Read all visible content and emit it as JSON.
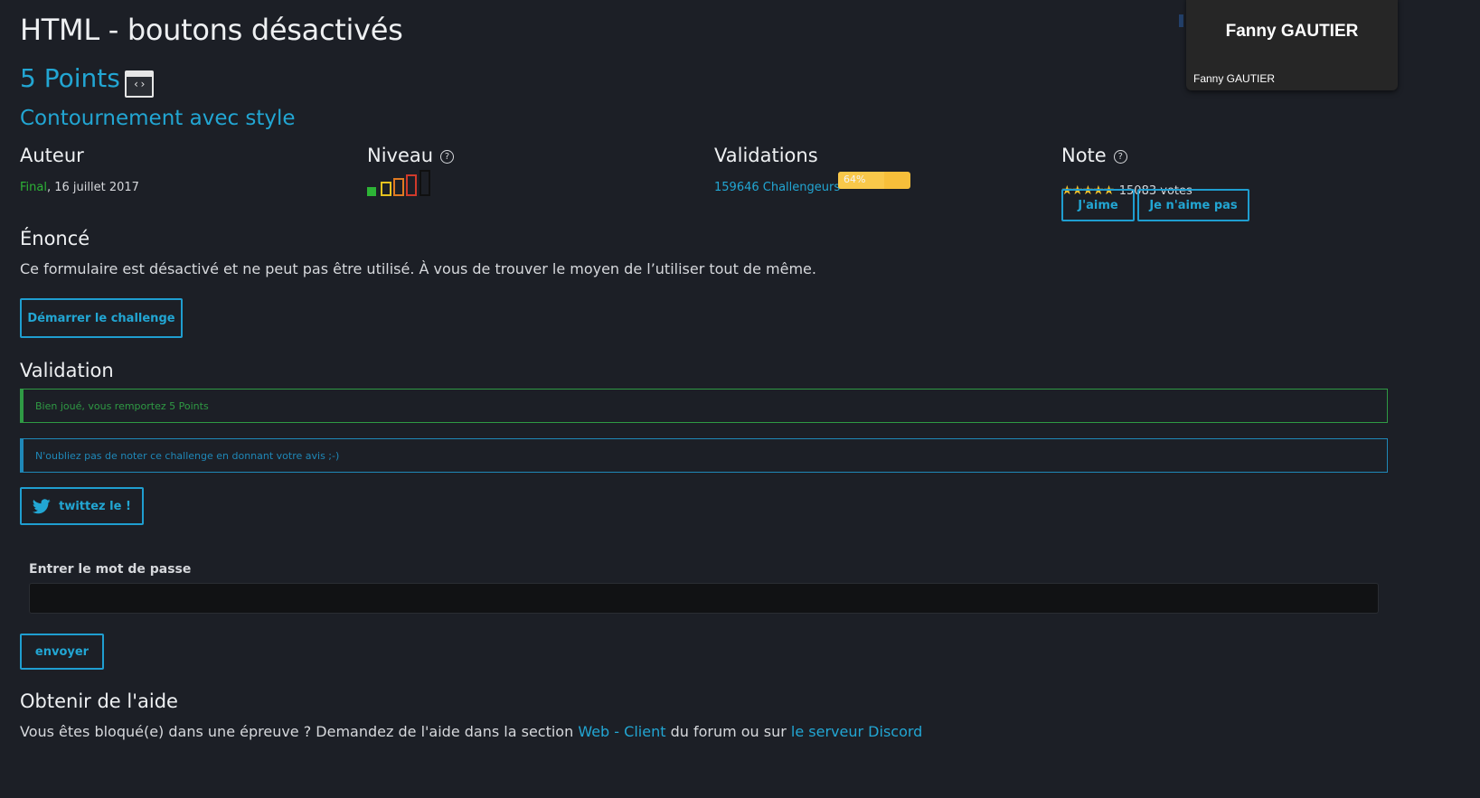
{
  "challenge": {
    "title": "HTML - boutons désactivés",
    "points": "5 Points",
    "subtitle": "Contournement avec style"
  },
  "author": {
    "heading": "Auteur",
    "name": "Final",
    "date": ",  16 juillet 2017"
  },
  "level": {
    "heading": "Niveau",
    "help_icon": "?"
  },
  "validations": {
    "heading": "Validations",
    "challengers": "159646 Challengeurs",
    "percent_label": "64%",
    "percent": 64
  },
  "note": {
    "heading": "Note",
    "help_icon": "?",
    "stars": "★★★★★",
    "votes": "15083 votes",
    "like": "J'aime",
    "dislike": "Je n'aime pas"
  },
  "statement": {
    "heading": "Énoncé",
    "text": "Ce formulaire est désactivé et ne peut pas être utilisé. À vous de trouver le moyen de l’utiliser tout de même.",
    "start_button": "Démarrer le challenge"
  },
  "validation": {
    "heading": "Validation",
    "success": "Bien joué, vous remportez 5 Points",
    "reminder": "N'oubliez pas de noter ce challenge en donnant votre avis ;-)",
    "tweet_button": "twittez le !"
  },
  "form": {
    "label": "Entrer le mot de passe",
    "value": "",
    "submit": "envoyer"
  },
  "help": {
    "heading": "Obtenir de l'aide",
    "text_before": "Vous êtes bloqué(e) dans une épreuve ? Demandez de l'aide dans la section ",
    "forum_link": "Web - Client",
    "text_middle": " du forum ou sur ",
    "discord_link": "le serveur Discord"
  },
  "user": {
    "name_big": "Fanny GAUTIER",
    "name_small": "Fanny GAUTIER"
  },
  "colors": {
    "accent": "#22a6d3",
    "success": "#2f9a44",
    "background": "#1c1f26"
  }
}
